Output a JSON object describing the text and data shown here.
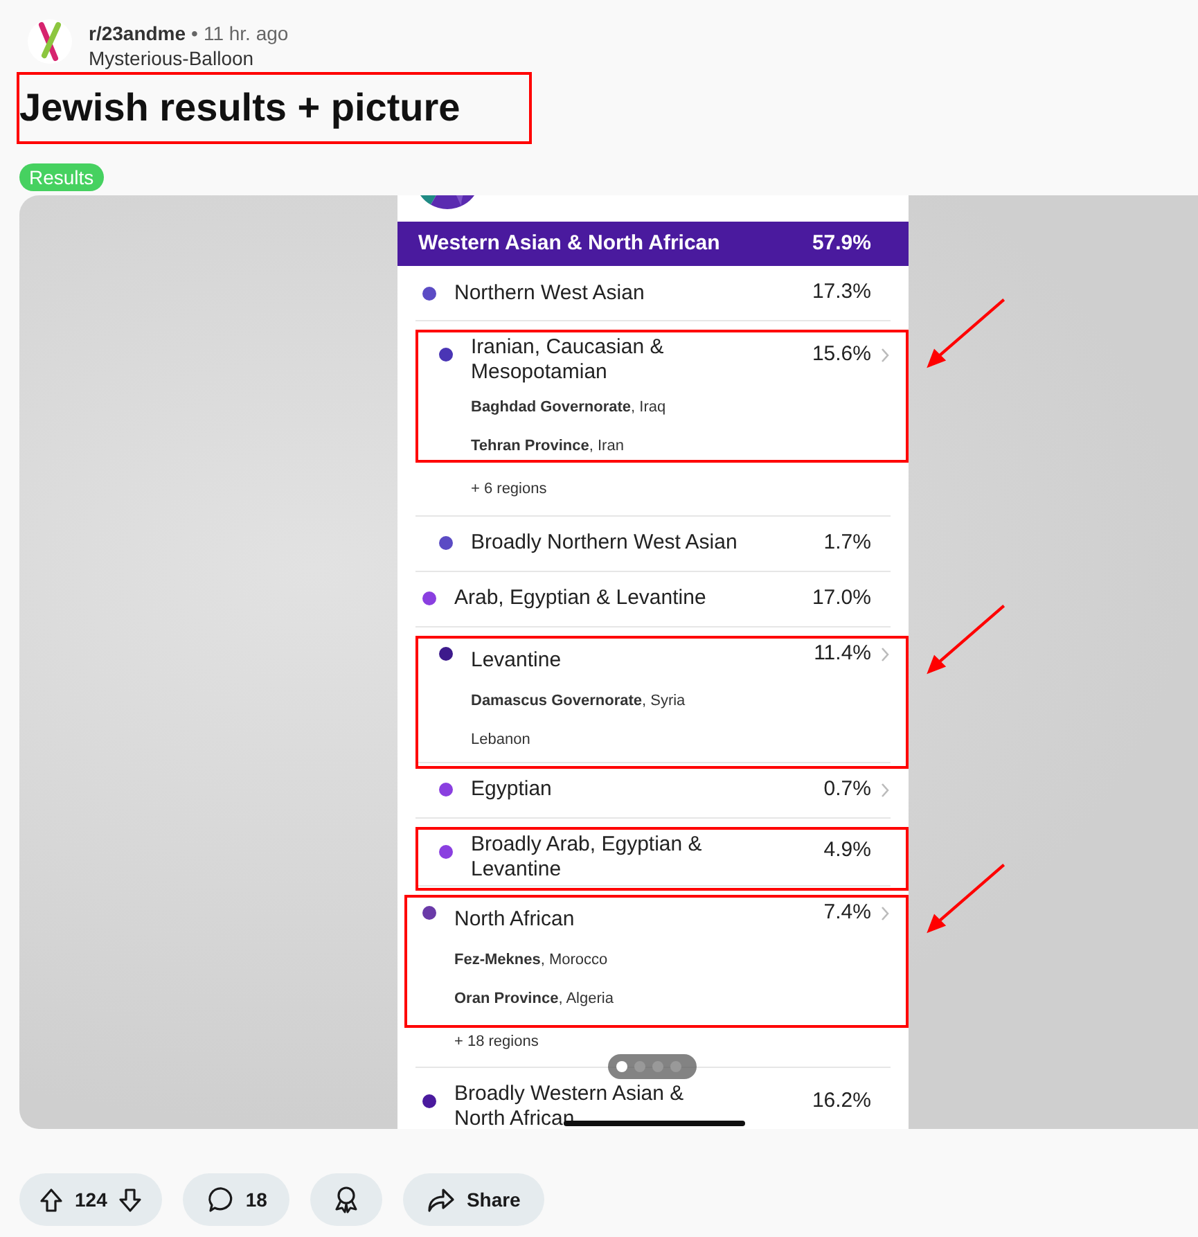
{
  "post": {
    "subreddit": "r/23andme",
    "separator": "•",
    "time": "11 hr. ago",
    "author": "Mysterious-Balloon",
    "title": "Jewish results + picture",
    "title_highlighted": true,
    "flair": "Results"
  },
  "screenshot": {
    "header": {
      "name": "Western Asian & North African",
      "percent": "57.9%"
    },
    "rows": [
      {
        "name": "Northern West Asian",
        "percent": "17.3%",
        "color": "#5b4bc4",
        "chevron": false,
        "highlighted": false,
        "arrow": false,
        "children": [
          {
            "name": "Iranian, Caucasian & Mesopotamian",
            "percent": "15.6%",
            "color": "#4a35b5",
            "chevron": true,
            "highlighted": true,
            "arrow": true,
            "regions": [
              "**Baghdad Governorate**, Iraq",
              "**Tehran Province**, Iran"
            ],
            "more": "+ 6 regions"
          },
          {
            "name": "Broadly Northern West Asian",
            "percent": "1.7%",
            "color": "#5b4bc4",
            "chevron": false,
            "highlighted": false,
            "arrow": false
          }
        ]
      },
      {
        "name": "Arab, Egyptian & Levantine",
        "percent": "17.0%",
        "color": "#8a3fe0",
        "chevron": false,
        "highlighted": false,
        "arrow": false,
        "children": [
          {
            "name": "Levantine",
            "percent": "11.4%",
            "color": "#3d1a8c",
            "chevron": true,
            "highlighted": true,
            "arrow": true,
            "regions": [
              "**Damascus Governorate**, Syria",
              "Lebanon"
            ]
          },
          {
            "name": "Egyptian",
            "percent": "0.7%",
            "color": "#8a3fe0",
            "chevron": true,
            "highlighted": false,
            "arrow": false
          },
          {
            "name": "Broadly Arab, Egyptian & Levantine",
            "percent": "4.9%",
            "color": "#8a3fe0",
            "chevron": false,
            "highlighted": true,
            "arrow": false
          }
        ]
      },
      {
        "name": "North African",
        "percent": "7.4%",
        "color": "#6a3aa8",
        "chevron": true,
        "highlighted": true,
        "arrow": true,
        "regions": [
          "**Fez-Meknes**, Morocco",
          "**Oran Province**, Algeria"
        ],
        "more": "+ 18 regions"
      },
      {
        "name": "Broadly Western Asian & North African",
        "percent": "16.2%",
        "color": "#4a1a9e",
        "chevron": false,
        "highlighted": false,
        "arrow": false
      }
    ],
    "pages": [
      {
        "selected": true
      },
      {
        "selected": false
      },
      {
        "selected": false
      },
      {
        "selected": false
      }
    ]
  },
  "actions": {
    "score": "124",
    "comments": "18",
    "share": "Share"
  }
}
